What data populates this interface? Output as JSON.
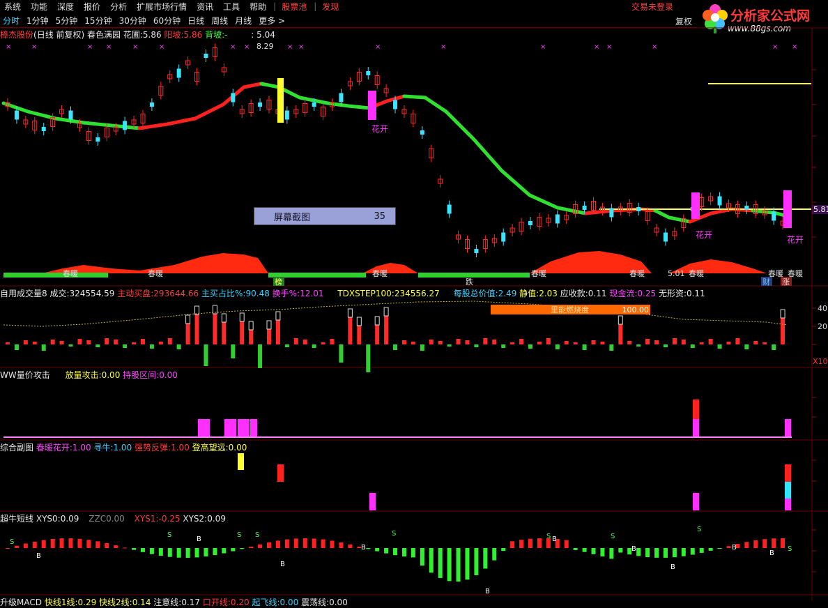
{
  "menu": {
    "items": [
      "系统",
      "功能",
      "深度",
      "报价",
      "分析",
      "扩展市场行情",
      "资讯",
      "工具",
      "帮助"
    ],
    "stock_pool": "股票池",
    "alert": "发现",
    "login": "交易未登录"
  },
  "periods": {
    "items": [
      "分时",
      "1分钟",
      "5分钟",
      "15分钟",
      "30分钟",
      "60分钟",
      "日线",
      "周线",
      "月线",
      "更多 >"
    ],
    "restore": "复权"
  },
  "logo": {
    "title": "分析家公式网",
    "url": "www.88gs.com"
  },
  "main_legend": {
    "stock": "樟杰股份",
    "mode": "(日线 前复权)",
    "formula": "春色满园",
    "flower_label": "花圃:",
    "flower_value": "5.86",
    "yang_label": "阳坡:",
    "yang_value": "5.86",
    "back_label": "背坡:",
    "back_value": "-",
    "extra_value": ": 5.04"
  },
  "main_chart": {
    "high_label": "8.29",
    "low_label": "5.01",
    "price_tag": "5.81",
    "labels": [
      "花开",
      "花开",
      "花开",
      "花开",
      "春暖",
      "春暖",
      "春暖",
      "春暖",
      "春暖",
      "春暖",
      "春暖",
      "春暖",
      "榜",
      "跌",
      "财",
      "涨"
    ]
  },
  "screenshot_box": {
    "label": "屏幕截图",
    "value": "35"
  },
  "volume_legend": {
    "name": "自用成交量8",
    "vol_label": "成交:",
    "vol_value": "324554.59",
    "buy_label": "主动买盘:",
    "buy_value": "293644.66",
    "ratio_label": "主买占比%:",
    "ratio_value": "90.48",
    "turn_label": "换手%:",
    "turn_value": "12.01",
    "step_label": "TDXSTEP100:",
    "step_value": "234556.27",
    "val_label": "每股总价值:",
    "val_value": "2.49",
    "static_label": "静值:",
    "static_value": "2.03",
    "recv_label": "应收款:",
    "recv_value": "0.11",
    "cash_label": "现金流:",
    "cash_value": "0.25",
    "intang_label": "无形资:",
    "intang_value": "0.11",
    "orange_label": "里能燃烧度",
    "orange_value": "100.00",
    "axis_top": "40",
    "axis_mid": "20",
    "axis_unit": "X10"
  },
  "ww_legend": {
    "name": "WW量价攻击",
    "a_label": "放量攻击:",
    "a_value": "0.00",
    "b_label": "持股区间:",
    "b_value": "0.00"
  },
  "combo_legend": {
    "name": "综合副图",
    "a_label": "春暖花开:",
    "a_value": "1.00",
    "b_label": "寻牛:",
    "b_value": "1.00",
    "c_label": "强势反弹:",
    "c_value": "1.00",
    "d_label": "登高望远:",
    "d_value": "0.00"
  },
  "short_legend": {
    "name": "超牛短线",
    "xys0_label": "XYS0:",
    "xys0_value": "0.09",
    "zz_label": "ZZC0.00",
    "xys1_label": "XYS1:",
    "xys1_value": "-0.25",
    "xys2_label": "XYS2:",
    "xys2_value": "0.09",
    "s_mark": "S",
    "b_mark": "B"
  },
  "macd_legend": {
    "name": "升级MACD",
    "a_label": "快线1线:",
    "a_value": "0.29",
    "b_label": "快线2线:",
    "b_value": "0.14",
    "c_label": "注意线:",
    "c_value": "0.17",
    "d_label": "口开线:",
    "d_value": "0.20",
    "e_label": "起飞线:",
    "e_value": "0.00",
    "f_label": "震荡线:",
    "f_value": "0.00"
  },
  "colors": {
    "up": "#ff2a2a",
    "down": "#39e6ff",
    "ma_up": "#ff2020",
    "ma_down": "#30e030",
    "magenta": "#ff30ff",
    "yellow": "#ffff30",
    "panel_border": "#6a0000"
  }
}
